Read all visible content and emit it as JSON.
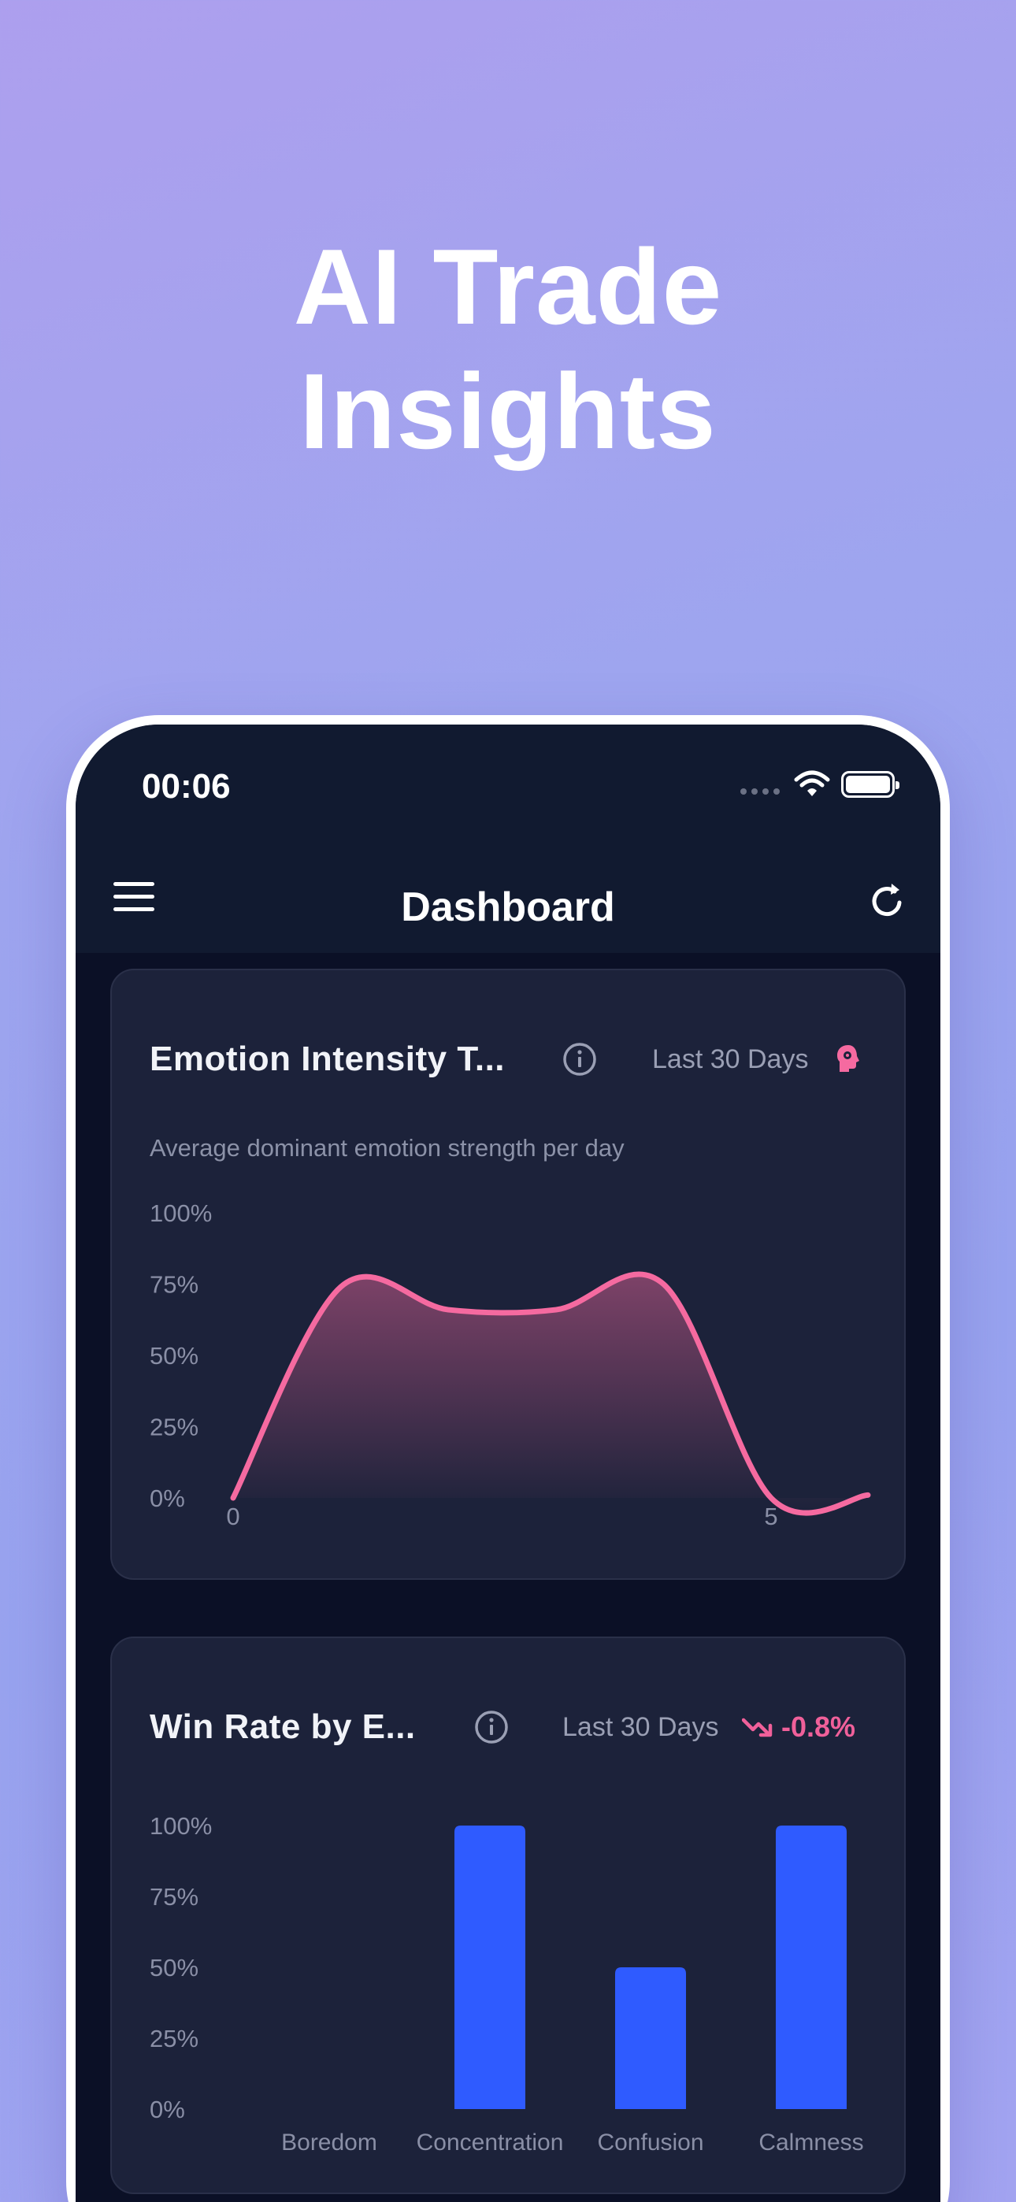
{
  "hero": {
    "line1": "AI Trade",
    "line2": "Insights"
  },
  "status_bar": {
    "time": "00:06",
    "icons": [
      "signal-dots-icon",
      "wifi-icon",
      "battery-icon"
    ]
  },
  "header": {
    "title": "Dashboard",
    "menu_icon": "hamburger-menu-icon",
    "refresh_icon": "refresh-icon"
  },
  "emotion_card": {
    "title": "Emotion Intensity T...",
    "period": "Last 30 Days",
    "subtitle": "Average dominant emotion strength per day",
    "icon": "brain-icon",
    "accent": "#f56aa0"
  },
  "winrate_card": {
    "title": "Win Rate by E...",
    "period": "Last 30 Days",
    "trend": "-0.8%",
    "trend_icon": "trending-down-icon",
    "trend_color": "#f0609a",
    "bar_color": "#2f5bff"
  },
  "chart_data": [
    {
      "type": "area",
      "title": "Emotion Intensity T...",
      "subtitle": "Average dominant emotion strength per day",
      "y_tick_labels": [
        "0%",
        "25%",
        "50%",
        "75%",
        "100%"
      ],
      "x_tick_labels": [
        "0",
        "5"
      ],
      "ylim": [
        0,
        100
      ],
      "xlim": [
        0,
        5.9
      ],
      "x": [
        0,
        1,
        2,
        3,
        4,
        5,
        5.9
      ],
      "values": [
        0,
        74,
        66,
        66,
        75,
        0,
        1
      ],
      "smooth": true,
      "grid": false,
      "color": "#f56aa0"
    },
    {
      "type": "bar",
      "title": "Win Rate by E...",
      "categories": [
        "Boredom",
        "Concentration",
        "Confusion",
        "Calmness"
      ],
      "values": [
        0,
        100,
        50,
        100
      ],
      "y_tick_labels": [
        "0%",
        "25%",
        "50%",
        "75%",
        "100%"
      ],
      "ylim": [
        0,
        100
      ],
      "grid": false,
      "color": "#2f5bff"
    }
  ]
}
